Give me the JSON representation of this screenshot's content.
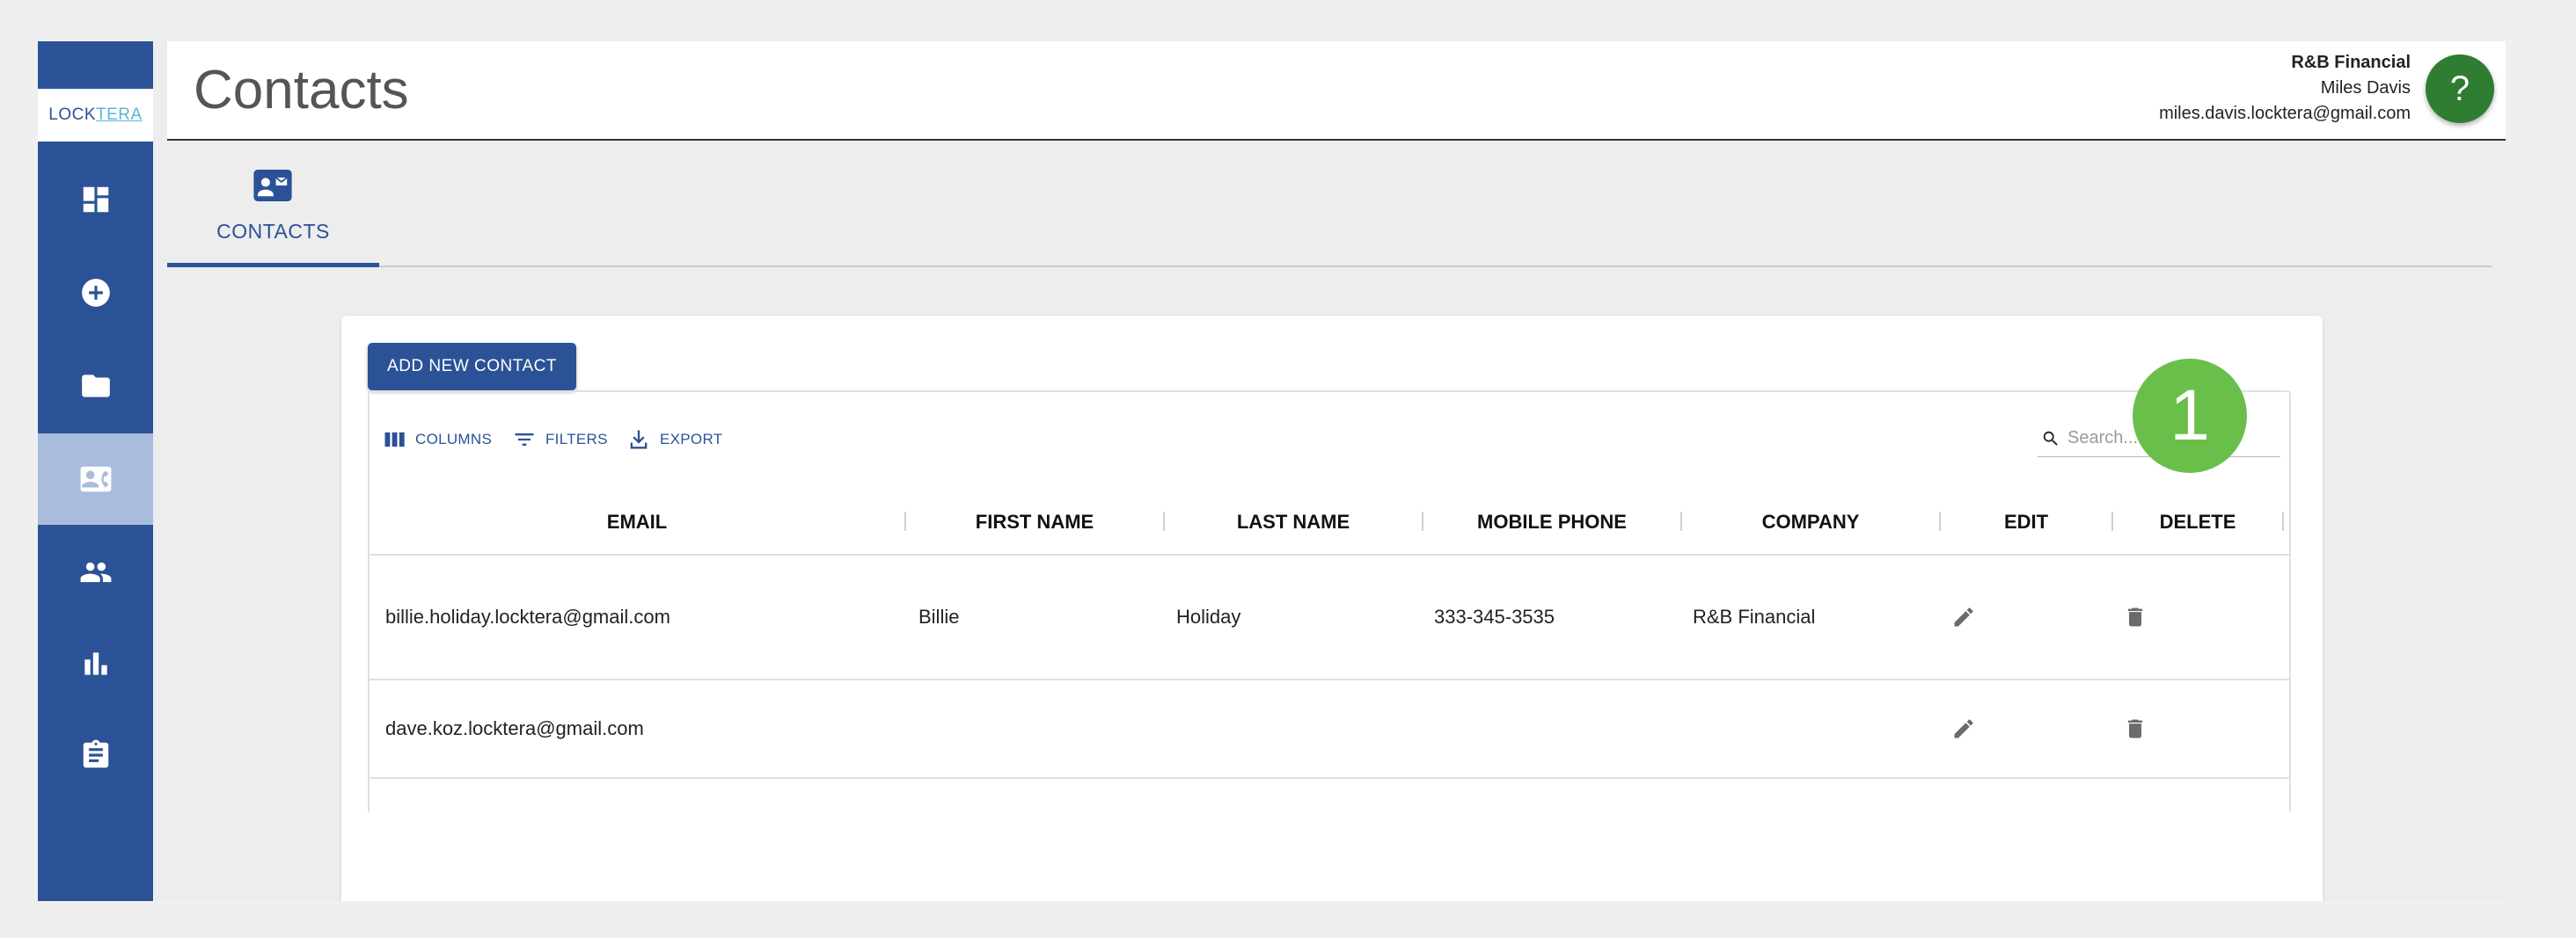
{
  "app": {
    "logo_left": "LOCK",
    "logo_right": "TERA",
    "page_title": "Contacts"
  },
  "sidebar": {
    "items": [
      {
        "icon": "dashboard-icon",
        "active": false
      },
      {
        "icon": "add-circle-icon",
        "active": false
      },
      {
        "icon": "folder-icon",
        "active": false
      },
      {
        "icon": "contact-card-icon",
        "active": true
      },
      {
        "icon": "people-icon",
        "active": false
      },
      {
        "icon": "bar-chart-icon",
        "active": false
      },
      {
        "icon": "clipboard-icon",
        "active": false
      }
    ]
  },
  "user": {
    "org": "R&B Financial",
    "name": "Miles Davis",
    "email": "miles.davis.locktera@gmail.com",
    "help_label": "?"
  },
  "tabs": [
    {
      "label": "CONTACTS",
      "icon": "contact-card-icon",
      "active": true
    }
  ],
  "toolbar": {
    "add_label": "ADD NEW CONTACT",
    "columns_label": "COLUMNS",
    "filters_label": "FILTERS",
    "export_label": "EXPORT",
    "search_placeholder": "Search..."
  },
  "table": {
    "columns": [
      "EMAIL",
      "FIRST NAME",
      "LAST NAME",
      "MOBILE PHONE",
      "COMPANY",
      "EDIT",
      "DELETE"
    ],
    "rows": [
      {
        "email": "billie.holiday.locktera@gmail.com",
        "first_name": "Billie",
        "last_name": "Holiday",
        "mobile_phone": "333-345-3535",
        "company": "R&B Financial"
      },
      {
        "email": "dave.koz.locktera@gmail.com",
        "first_name": "",
        "last_name": "",
        "mobile_phone": "",
        "company": ""
      }
    ]
  },
  "callout": {
    "label": "1"
  },
  "colors": {
    "brand": "#2b5296",
    "sidebar_active": "#a9bcdc",
    "help": "#2e7d32",
    "callout": "#6abf4b"
  }
}
